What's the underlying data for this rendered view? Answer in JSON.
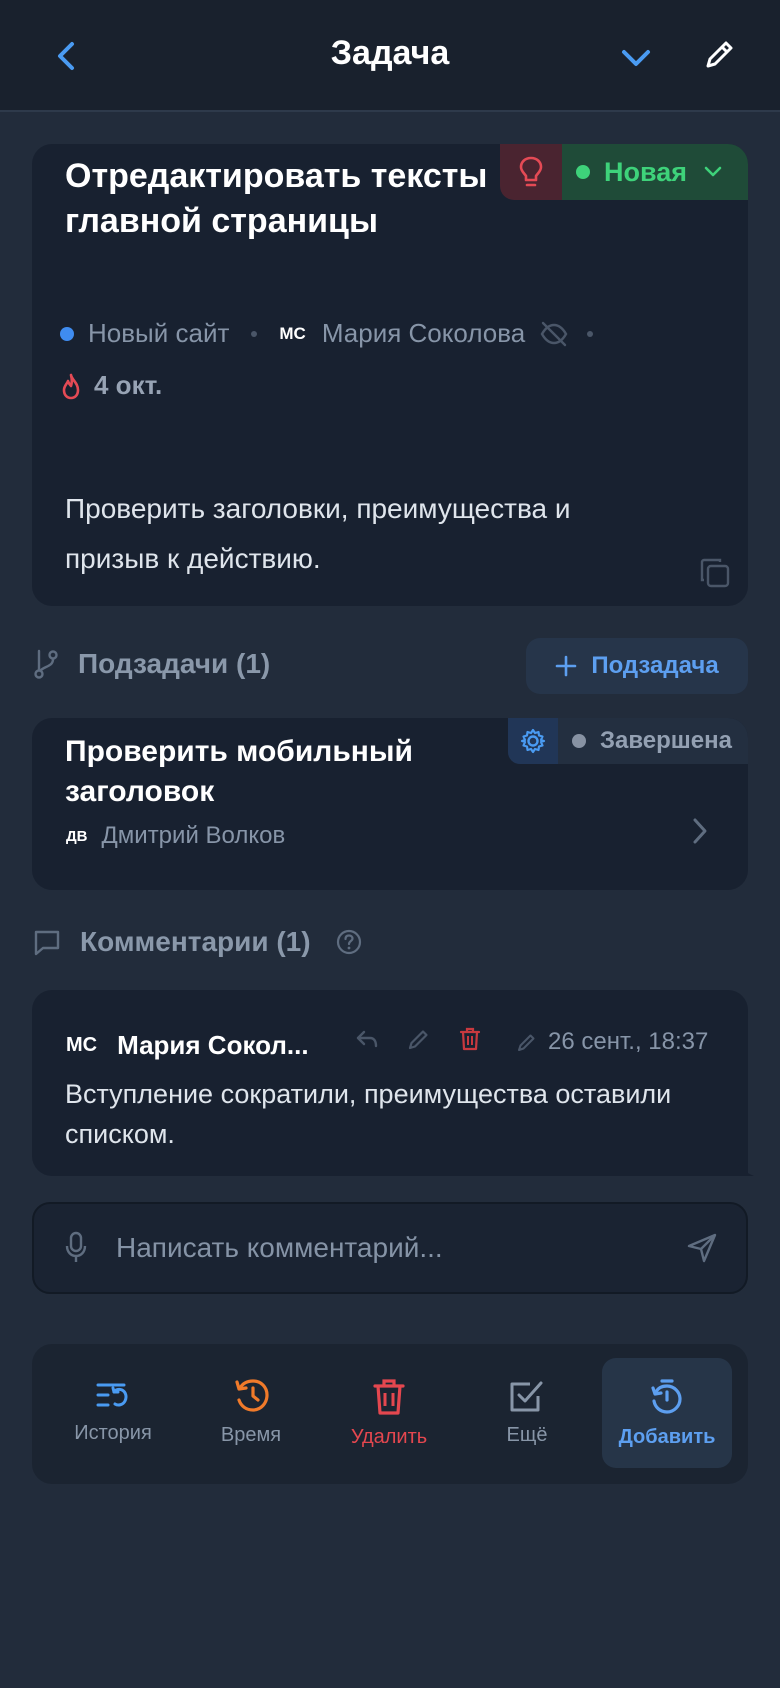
{
  "header": {
    "title": "Задача",
    "back_icon": "chevron-left-icon",
    "collapse_icon": "chevron-down-icon",
    "edit_icon": "pencil-icon"
  },
  "task": {
    "title": "Отредактировать тексты главной страницы",
    "priority_icon": "lightbulb-icon",
    "status": "Новая",
    "project": "Новый сайт",
    "assignee_initials": "МС",
    "assignee": "Мария Соколова",
    "due_date": "4 окт.",
    "description": "Проверить заголовки, преимущества и призыв к действию."
  },
  "subtasks": {
    "heading": "Подзадачи (1)",
    "add_label": "Подзадача",
    "items": [
      {
        "title": "Проверить мобильный заголовок",
        "status": "Завершена",
        "assignee_initials": "ДВ",
        "assignee": "Дмитрий Волков"
      }
    ]
  },
  "comments": {
    "heading": "Комментарии (1)",
    "items": [
      {
        "author_initials": "МС",
        "author": "Мария Сокол...",
        "date": "26 сент., 18:37",
        "text": "Вступление сократили, преимущества оставили списком."
      }
    ],
    "input_placeholder": "Написать комментарий..."
  },
  "toolbar": {
    "history": "История",
    "time": "Время",
    "delete": "Удалить",
    "more": "Ещё",
    "add": "Добавить"
  },
  "colors": {
    "background": "#222c3b",
    "card": "#182130",
    "status_new": "#3ed27a",
    "accent": "#5d9ff0",
    "danger": "#e4474f",
    "timer": "#f07a2a"
  }
}
